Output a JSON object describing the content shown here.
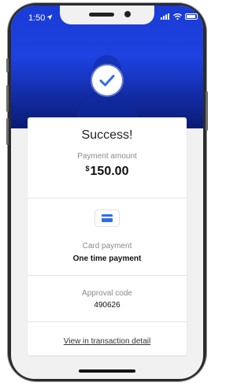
{
  "status_bar": {
    "time": "1:50"
  },
  "receipt": {
    "title": "Success!",
    "amount_label": "Payment amount",
    "currency_symbol": "$",
    "amount_value": "150.00",
    "payment_method_label": "Card payment",
    "payment_type": "One time payment",
    "approval_label": "Approval code",
    "approval_code": "490626",
    "detail_link": "View in transaction detail"
  },
  "colors": {
    "brand_blue": "#1d42e0",
    "check_blue": "#2f6ee8"
  }
}
